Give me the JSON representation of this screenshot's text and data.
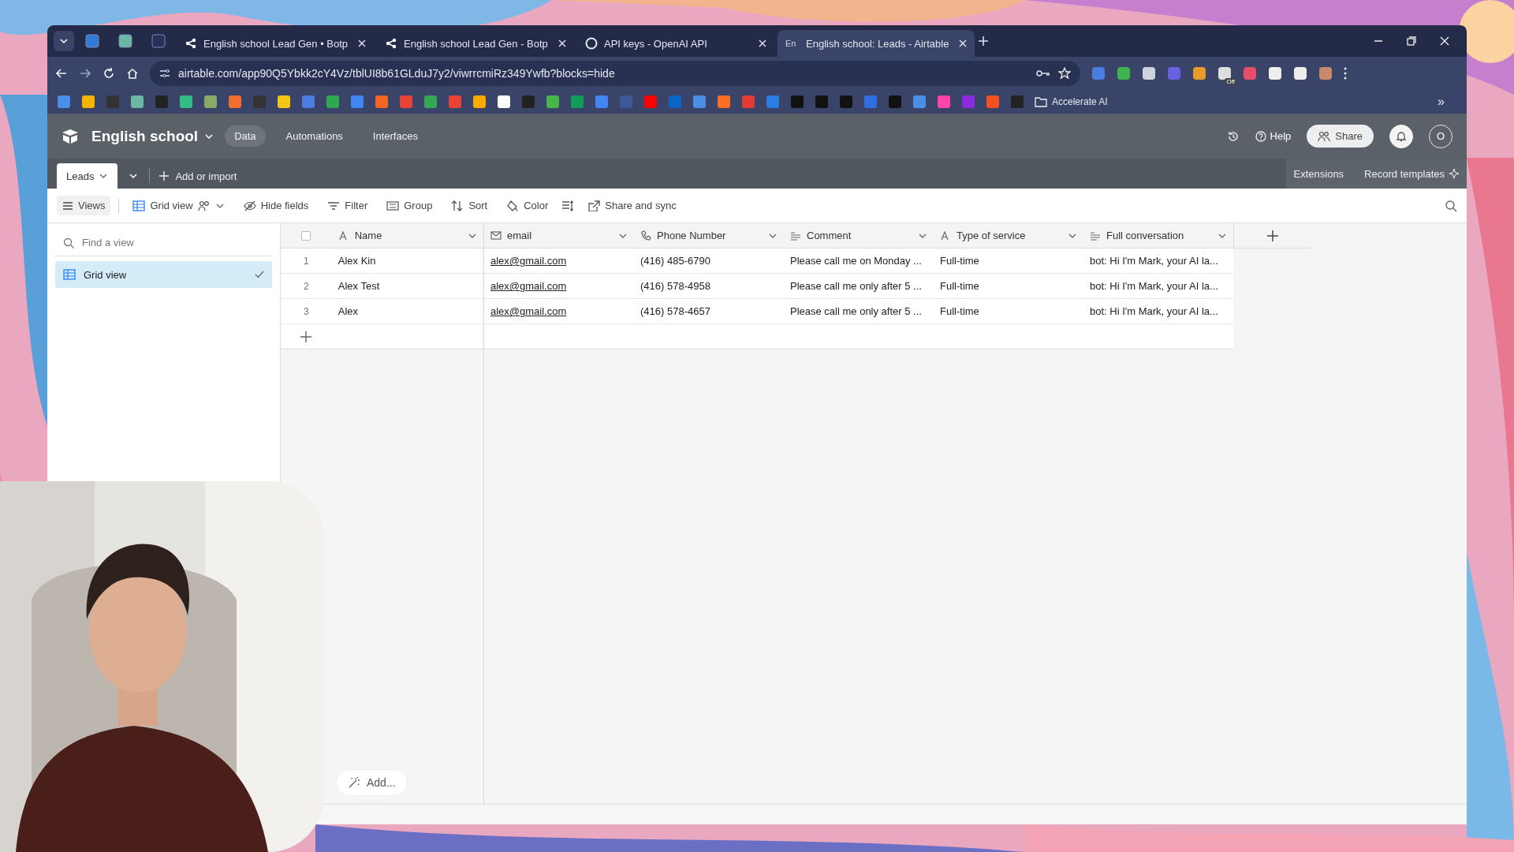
{
  "browser": {
    "tabs": [
      {
        "title": "English school Lead Gen • Botp",
        "selected": false
      },
      {
        "title": "English school Lead Gen - Botp",
        "selected": false
      },
      {
        "title": "API keys - OpenAI API",
        "selected": false
      },
      {
        "title": "English school: Leads - Airtable",
        "favicon_text": "En",
        "selected": true
      }
    ],
    "url": "airtable.com/app90Q5Ybkk2cY4Vz/tblUI8b61GLduJ7y2/viwrrcmiRz349Ywfb?blocks=hide",
    "extension_badge": "Off",
    "bookmark_folder": "Accelerate AI",
    "more_bookmarks": "»"
  },
  "base": {
    "name": "English school",
    "nav": [
      {
        "label": "Data",
        "selected": true
      },
      {
        "label": "Automations",
        "selected": false
      },
      {
        "label": "Interfaces",
        "selected": false
      }
    ],
    "help": "Help",
    "share": "Share",
    "avatar": "O"
  },
  "tables": {
    "tabs": [
      {
        "label": "Leads",
        "selected": true
      }
    ],
    "add": "Add or import",
    "extensions": "Extensions",
    "record_templates": "Record templates"
  },
  "toolbar": {
    "views": "Views",
    "view_name": "Grid view",
    "items": [
      {
        "kind": "hide",
        "label": "Hide fields"
      },
      {
        "kind": "filter",
        "label": "Filter"
      },
      {
        "kind": "group",
        "label": "Group"
      },
      {
        "kind": "sort",
        "label": "Sort"
      },
      {
        "kind": "color",
        "label": "Color"
      },
      {
        "kind": "height"
      },
      {
        "kind": "share",
        "label": "Share and sync"
      }
    ]
  },
  "sidebar": {
    "search": {
      "placeholder": "Find a view"
    },
    "views": [
      {
        "label": "Grid view",
        "selected": true
      }
    ],
    "add_button": "Add..."
  },
  "table": {
    "all_selected": false,
    "columns": [
      {
        "label": "Name",
        "kind": "text"
      },
      {
        "label": "email",
        "kind": "email"
      },
      {
        "label": "Phone Number",
        "kind": "phone"
      },
      {
        "label": "Comment",
        "kind": "longtext"
      },
      {
        "label": "Type of service",
        "kind": "text"
      },
      {
        "label": "Full conversation",
        "kind": "longtext"
      }
    ],
    "rows": [
      {
        "number": "1",
        "cells": [
          "Alex Kin",
          "alex@gmail.com",
          "(416) 485-6790",
          "Please call me on Monday ...",
          "Full-time",
          "bot: Hi I'm Mark, your AI la..."
        ]
      },
      {
        "number": "2",
        "cells": [
          "Alex Test",
          "alex@gmail.com",
          "(416) 578-4958",
          "Please call me only after 5 ...",
          "Full-time",
          "bot: Hi I'm Mark, your AI la..."
        ]
      },
      {
        "number": "3",
        "cells": [
          "Alex",
          "alex@gmail.com",
          "(416) 578-4657",
          "Please call me only after 5 ...",
          "Full-time",
          "bot: Hi I'm Mark, your AI la..."
        ]
      }
    ]
  }
}
